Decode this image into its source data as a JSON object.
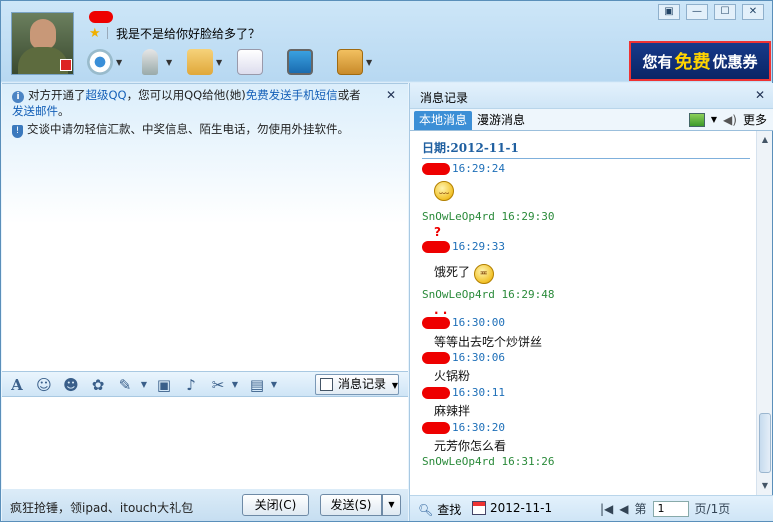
{
  "window": {
    "controls": [
      "▣",
      "—",
      "☐",
      "✕"
    ]
  },
  "header": {
    "signature": "我是不是给你好脸给多了？",
    "ad": {
      "pre": "您有",
      "highlight": "免费",
      "post": "优惠券"
    }
  },
  "notice": {
    "line1_a": "对方开通了",
    "line1_link1": "超级QQ",
    "line1_b": "，您可以用QQ给他(她)",
    "line1_link2": "免费发送手机短信",
    "line1_c": "或者",
    "line1_link3": "发送邮件",
    "line1_d": "。",
    "line2": "交谈中请勿轻信汇款、中奖信息、陌生电话，勿使用外挂软件。",
    "close": "✕"
  },
  "format_bar": {
    "record_button": "消息记录",
    "font_icon": "A",
    "emoji_icon": "☺",
    "vibrate_icon": "☻",
    "magic_icon": "✿",
    "scribble_icon": "✎",
    "image_icon": "▣",
    "music_icon": "♪",
    "scissors_icon": "✂",
    "briefcase_icon": "▤"
  },
  "footer": {
    "promo": "疯狂抢锤，领ipad、itouch大礼包",
    "close_button": "关闭(C)",
    "send_button": "发送(S)"
  },
  "history": {
    "title": "消息记录",
    "tabs": [
      "本地消息",
      "漫游消息"
    ],
    "more": "更多",
    "date_label": "日期:2012-11-1",
    "messages": [
      {
        "time": "16:29:24",
        "kind": "other",
        "text": "",
        "emoticon": "pout"
      },
      {
        "time": "SnOwLeOp4rd 16:29:30",
        "kind": "me",
        "text": "",
        "mark": "?"
      },
      {
        "time": "16:29:33",
        "kind": "other",
        "text": "饿死了",
        "emoticon": "hungry"
      },
      {
        "time": "SnOwLeOp4rd 16:29:48",
        "kind": "me",
        "text": "",
        "mark": ". ."
      },
      {
        "time": "16:30:00",
        "kind": "other",
        "text": "等等出去吃个炒饼丝"
      },
      {
        "time": "16:30:06",
        "kind": "other",
        "text": "火锅粉"
      },
      {
        "time": "16:30:11",
        "kind": "other",
        "text": "麻辣拌"
      },
      {
        "time": "16:30:20",
        "kind": "other",
        "text": "元芳你怎么看"
      },
      {
        "time": "SnOwLeOp4rd 16:31:26",
        "kind": "me",
        "text": ""
      }
    ],
    "footer": {
      "search": "查找",
      "date": "2012-11-1",
      "page_prefix": "第",
      "page_value": "1",
      "page_suffix": "页/1页"
    }
  }
}
